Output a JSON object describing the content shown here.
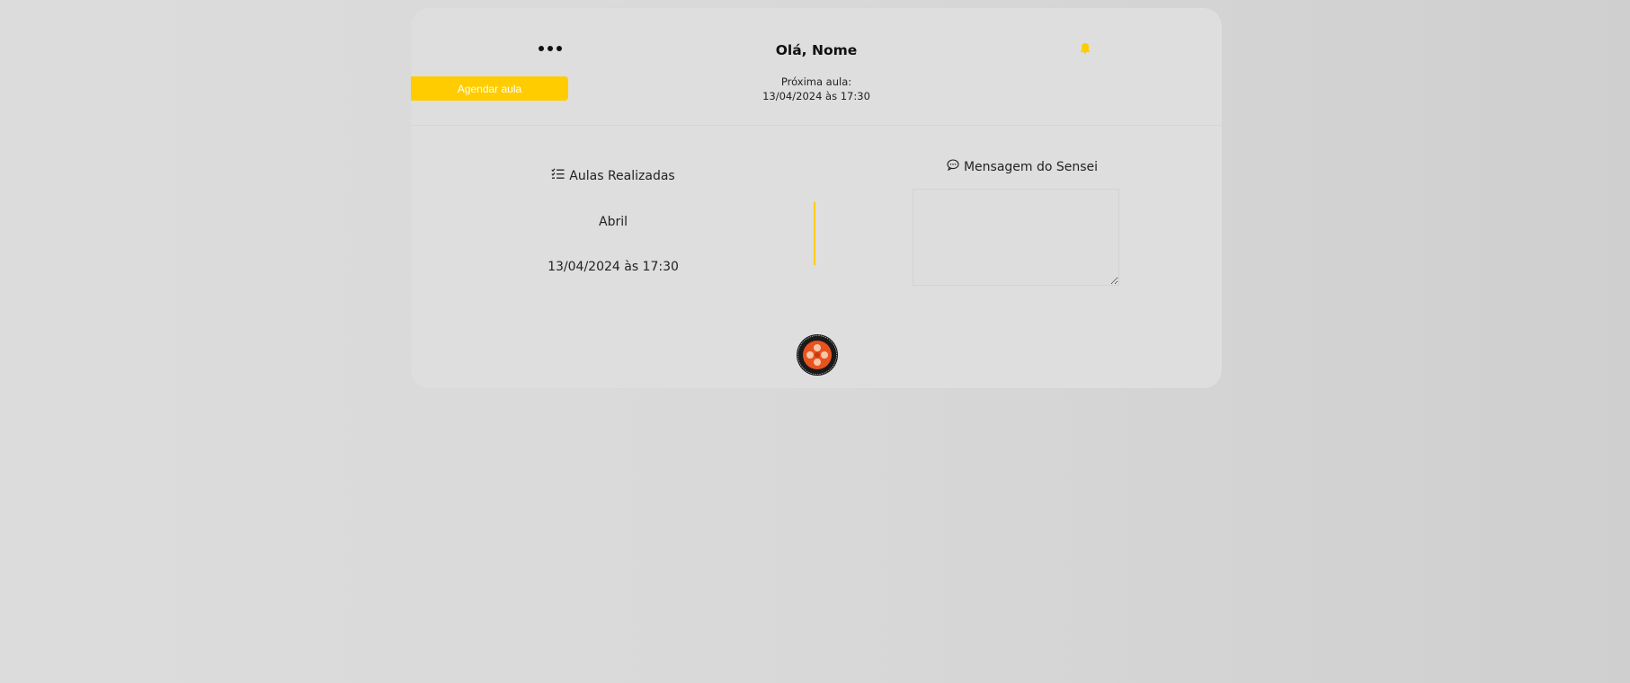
{
  "header": {
    "greeting": "Olá, Nome",
    "menu_icon": "more-horizontal-icon",
    "notification_icon": "bell-icon"
  },
  "schedule": {
    "button_label": "Agendar aula",
    "next_class_label": "Próxima aula:",
    "next_class_datetime": "13/04/2024 às 17:30"
  },
  "classes_done": {
    "title": "Aulas Realizadas",
    "icon": "checklist-icon",
    "month": "Abril",
    "items": [
      "13/04/2024 às 17:30"
    ]
  },
  "sensei_message": {
    "title": "Mensagem do Sensei",
    "icon": "speech-bubble-icon",
    "value": ""
  },
  "footer": {
    "logo_icon": "dojo-logo"
  },
  "colors": {
    "accent": "#ffcc00",
    "card_background": "#dedede",
    "page_background": "#d8d8d8"
  }
}
